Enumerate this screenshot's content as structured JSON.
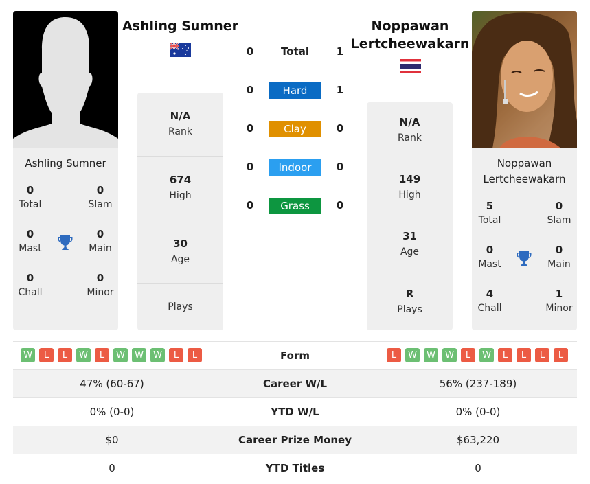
{
  "colors": {
    "hard": "#0a6bc4",
    "clay": "#e09000",
    "indoor": "#2b9ff0",
    "grass": "#0d9640",
    "win": "#6cbf73",
    "loss": "#ec5b44",
    "trophy": "#2e6bbf"
  },
  "player1": {
    "name": "Ashling Sumner",
    "flag": "australia-flag",
    "photo": "silhouette-placeholder",
    "card_name": "Ashling Sumner",
    "titles": {
      "total": {
        "value": "0",
        "label": "Total"
      },
      "slam": {
        "value": "0",
        "label": "Slam"
      },
      "mast": {
        "value": "0",
        "label": "Mast"
      },
      "main": {
        "value": "0",
        "label": "Main"
      },
      "chall": {
        "value": "0",
        "label": "Chall"
      },
      "minor": {
        "value": "0",
        "label": "Minor"
      }
    },
    "stats": {
      "rank": {
        "value": "N/A",
        "label": "Rank"
      },
      "high": {
        "value": "674",
        "label": "High"
      },
      "age": {
        "value": "30",
        "label": "Age"
      },
      "plays": {
        "value": "",
        "label": "Plays"
      }
    },
    "form": [
      "W",
      "L",
      "L",
      "W",
      "L",
      "W",
      "W",
      "W",
      "L",
      "L"
    ]
  },
  "player2": {
    "name_line1": "Noppawan",
    "name_line2": "Lertcheewakarn",
    "flag": "thailand-flag",
    "photo": "player-photo",
    "card_name_line1": "Noppawan",
    "card_name_line2": "Lertcheewakarn",
    "titles": {
      "total": {
        "value": "5",
        "label": "Total"
      },
      "slam": {
        "value": "0",
        "label": "Slam"
      },
      "mast": {
        "value": "0",
        "label": "Mast"
      },
      "main": {
        "value": "0",
        "label": "Main"
      },
      "chall": {
        "value": "4",
        "label": "Chall"
      },
      "minor": {
        "value": "1",
        "label": "Minor"
      }
    },
    "stats": {
      "rank": {
        "value": "N/A",
        "label": "Rank"
      },
      "high": {
        "value": "149",
        "label": "High"
      },
      "age": {
        "value": "31",
        "label": "Age"
      },
      "plays": {
        "value": "R",
        "label": "Plays"
      }
    },
    "form": [
      "L",
      "W",
      "W",
      "W",
      "L",
      "W",
      "L",
      "L",
      "L",
      "L"
    ]
  },
  "h2h": {
    "total": {
      "label": "Total",
      "p1": "0",
      "p2": "1"
    },
    "hard": {
      "label": "Hard",
      "p1": "0",
      "p2": "1"
    },
    "clay": {
      "label": "Clay",
      "p1": "0",
      "p2": "0"
    },
    "indoor": {
      "label": "Indoor",
      "p1": "0",
      "p2": "0"
    },
    "grass": {
      "label": "Grass",
      "p1": "0",
      "p2": "0"
    }
  },
  "comparison": {
    "form_label": "Form",
    "rows": [
      {
        "label": "Career W/L",
        "p1": "47% (60-67)",
        "p2": "56% (237-189)"
      },
      {
        "label": "YTD W/L",
        "p1": "0% (0-0)",
        "p2": "0% (0-0)"
      },
      {
        "label": "Career Prize Money",
        "p1": "$0",
        "p2": "$63,220"
      },
      {
        "label": "YTD Titles",
        "p1": "0",
        "p2": "0"
      }
    ]
  }
}
